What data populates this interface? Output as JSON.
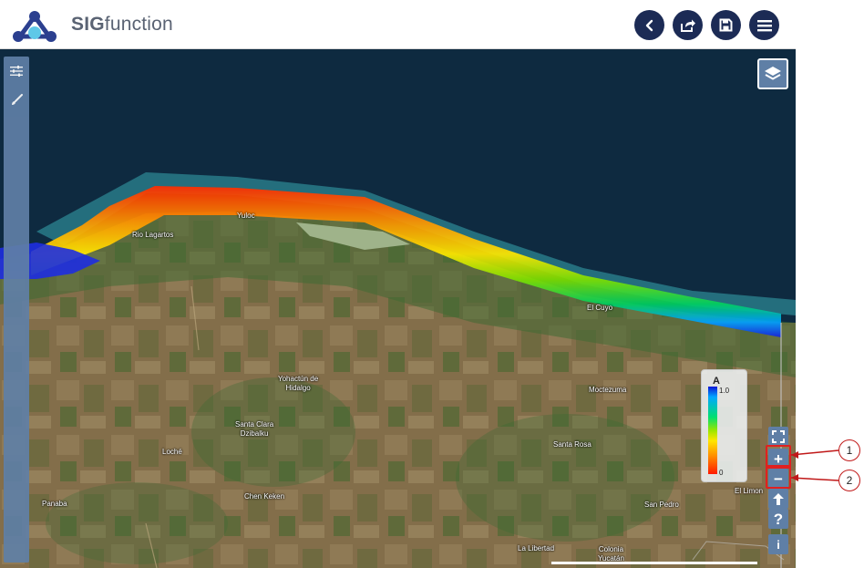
{
  "header": {
    "brand_bold": "SIG",
    "brand_rest": "function",
    "buttons": [
      {
        "name": "back-button",
        "icon": "chevron-left-icon"
      },
      {
        "name": "share-button",
        "icon": "share-icon"
      },
      {
        "name": "save-button",
        "icon": "floppy-disk-icon"
      },
      {
        "name": "menu-button",
        "icon": "hamburger-icon"
      }
    ]
  },
  "sidebar": {
    "items": [
      {
        "name": "settings-sliders-button",
        "icon": "sliders-icon"
      },
      {
        "name": "style-brush-button",
        "icon": "paintbrush-icon"
      }
    ]
  },
  "map": {
    "places": [
      {
        "label": "Rio Lagartos"
      },
      {
        "label": "Yuloc"
      },
      {
        "label": "El Cuyo"
      },
      {
        "label": "Yohactún de\nHidalgo"
      },
      {
        "label": "Santa Clara\nDzibalku"
      },
      {
        "label": "Moctezuma"
      },
      {
        "label": "Santa Rosa"
      },
      {
        "label": "Loché"
      },
      {
        "label": "Chen Keken"
      },
      {
        "label": "Panaba"
      },
      {
        "label": "San Pedro"
      },
      {
        "label": "El Limon"
      },
      {
        "label": "La Libertad"
      },
      {
        "label": "Colonia\nYucatán"
      }
    ],
    "legend": {
      "title": "A",
      "max": "1.0",
      "min": "0"
    },
    "controls": [
      {
        "name": "fullscreen-button",
        "icon": "fullscreen-icon"
      },
      {
        "name": "zoom-in-button",
        "label": "+"
      },
      {
        "name": "zoom-out-button",
        "label": "−"
      },
      {
        "name": "north-arrow-button",
        "icon": "arrow-up-icon"
      },
      {
        "name": "help-button",
        "label": "?"
      },
      {
        "name": "info-button",
        "label": "i"
      }
    ]
  },
  "callouts": [
    {
      "label": "1"
    },
    {
      "label": "2"
    }
  ],
  "colors": {
    "header_button": "#1c2b55",
    "control_bg": "#5f7fa6",
    "sea": "#0e2a40",
    "land": "#7e6b4a",
    "highlight": "#e02020"
  }
}
